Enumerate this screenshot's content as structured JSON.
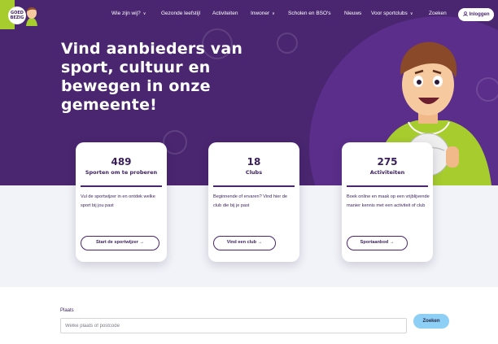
{
  "logo": {
    "line1": "GOED",
    "line2": "BEZIG"
  },
  "nav": {
    "items": [
      {
        "label": "Wie zijn wij?",
        "caret": "∨"
      },
      {
        "label": "Gezonde leefstijl",
        "caret": ""
      },
      {
        "label": "Activiteiten",
        "caret": ""
      },
      {
        "label": "Inwoner",
        "caret": "∨"
      },
      {
        "label": "Scholen en BSO's",
        "caret": ""
      },
      {
        "label": "Nieuws",
        "caret": ""
      },
      {
        "label": "Voor sportclubs",
        "caret": "∨"
      },
      {
        "label": "Zoeken",
        "caret": ""
      }
    ],
    "login_label": "Inloggen",
    "login_icon": "user-icon"
  },
  "hero": {
    "title": "Vind aanbieders van sport, cultuur en bewegen in onze gemeente!"
  },
  "cards": [
    {
      "number": "489",
      "label": "Sporten om te proberen",
      "text": "Vul de sportwijzer in en ontdek welke sport bij jou past",
      "button": "Start de sportwijzer →"
    },
    {
      "number": "18",
      "label": "Clubs",
      "text": "Beginnende of ervaren? Vind hier de club die bij je past",
      "button": "Vind een club →"
    },
    {
      "number": "275",
      "label": "Activiteiten",
      "text": "Boek online en maak op een vrijblijvende manier kennis met een activiteit of club",
      "button": "Sportaanbod →"
    }
  ],
  "search": {
    "label": "Plaats",
    "placeholder": "Welke plaats of postcode",
    "value": "",
    "button": "Zoeken"
  },
  "colors": {
    "brand_purple": "#4a2670",
    "accent_lime": "#a6cc2e",
    "button_blue": "#8ecff5",
    "band_grey": "#f2f3f8"
  }
}
